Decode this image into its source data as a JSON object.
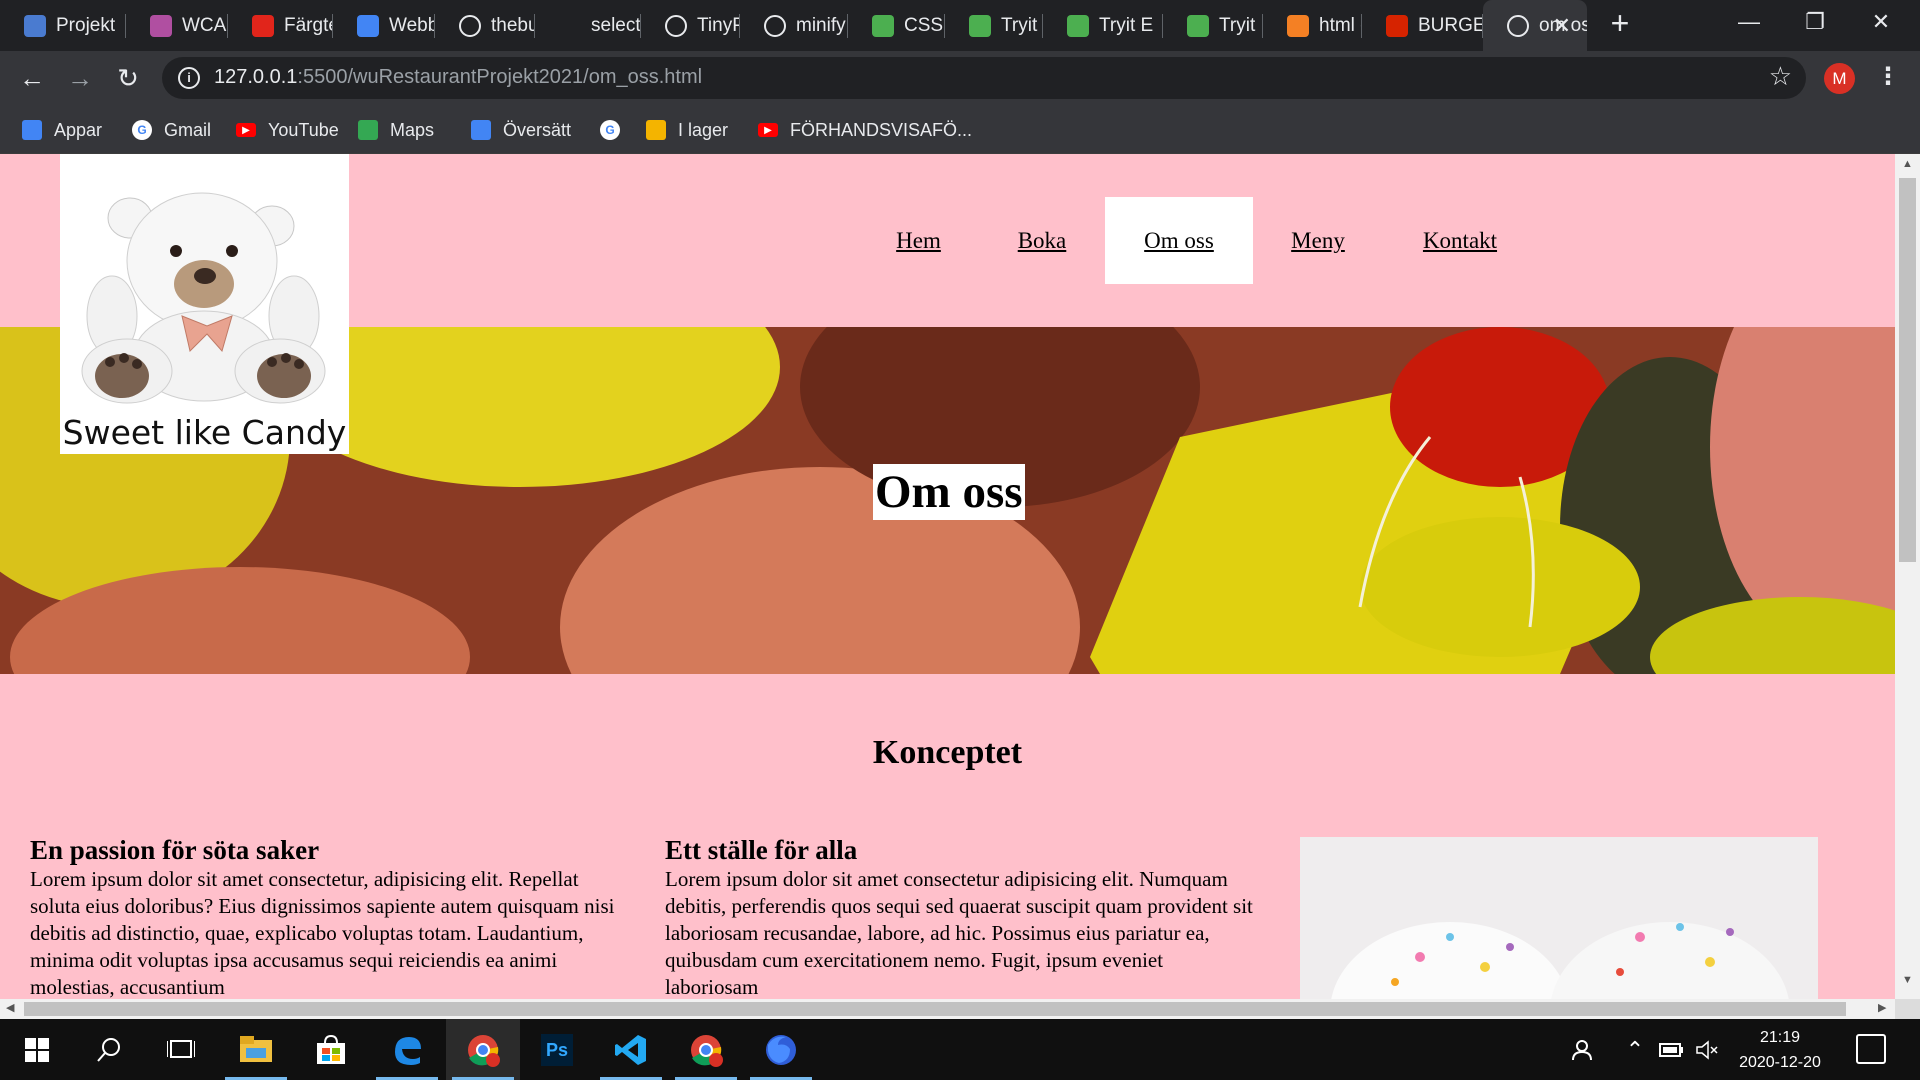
{
  "browser": {
    "tabs": [
      {
        "title": "Projekt",
        "icon": "contact-icon",
        "color": "#4a7bd0"
      },
      {
        "title": "WCAG",
        "icon": "wcag-icon",
        "color": "#b04fa1"
      },
      {
        "title": "Färgtema",
        "icon": "adobe-icon",
        "color": "#e1251b"
      },
      {
        "title": "Webbutveckling",
        "icon": "docs-icon",
        "color": "#4285f4"
      },
      {
        "title": "thebu",
        "icon": "globe-icon",
        "color": "#e8eaed"
      },
      {
        "title": "select",
        "icon": "none",
        "color": "#202124"
      },
      {
        "title": "TinyPNG",
        "icon": "panda-icon",
        "color": "#e8eaed"
      },
      {
        "title": "minify",
        "icon": "google-icon",
        "color": "#e8eaed"
      },
      {
        "title": "CSS Ir",
        "icon": "w3schools-icon",
        "color": "#4caf50"
      },
      {
        "title": "Tryit E",
        "icon": "w3schools-icon",
        "color": "#4caf50"
      },
      {
        "title": "Tryit E",
        "icon": "w3schools-icon",
        "color": "#4caf50"
      },
      {
        "title": "Tryit E",
        "icon": "w3schools-icon",
        "color": "#4caf50"
      },
      {
        "title": "html -",
        "icon": "stackoverflow-icon",
        "color": "#f48024"
      },
      {
        "title": "BURGER",
        "icon": "burgerking-icon",
        "color": "#d62300"
      },
      {
        "title": "om oss",
        "icon": "globe-icon",
        "color": "#e8eaed",
        "active": true
      }
    ],
    "url_host": "127.0.0.1",
    "url_rest": ":5500/wuRestaurantProjekt2021/om_oss.html",
    "bookmarks": [
      {
        "label": "Appar",
        "icon": "apps-grid-icon"
      },
      {
        "label": "Gmail",
        "icon": "google-icon"
      },
      {
        "label": "YouTube",
        "icon": "youtube-icon"
      },
      {
        "label": "Maps",
        "icon": "maps-pin-icon"
      },
      {
        "label": "Översätt",
        "icon": "translate-icon"
      },
      {
        "label": "",
        "icon": "google-icon"
      },
      {
        "label": "I lager",
        "icon": "chrome-icon"
      },
      {
        "label": "FÖRHANDSVISAFÖ...",
        "icon": "youtube-icon"
      }
    ],
    "profile_initial": "M"
  },
  "site": {
    "logo_text": "Sweet like Candy",
    "nav": [
      "Hem",
      "Boka",
      "Om oss",
      "Meny",
      "Kontakt"
    ],
    "active_nav": "Om oss",
    "hero_title": "Om oss",
    "section_title": "Konceptet",
    "columns": [
      {
        "heading": "En passion för söta saker",
        "text": "Lorem ipsum dolor sit amet consectetur, adipisicing elit. Repellat soluta eius doloribus? Eius dignissimos sapiente autem quisquam nisi debitis ad distinctio, quae, explicabo voluptas totam. Laudantium, minima odit voluptas ipsa accusamus sequi reiciendis ea animi molestias, accusantium"
      },
      {
        "heading": "Ett ställe för alla",
        "text": "Lorem ipsum dolor sit amet consectetur adipisicing elit. Numquam debitis, perferendis quos sequi sed quaerat suscipit quam provident sit laboriosam recusandae, labore, ad hic. Possimus eius pariatur ea, quibusdam cum exercitationem nemo. Fugit, ipsum eveniet laboriosam"
      }
    ]
  },
  "taskbar": {
    "apps": [
      "windows-start-icon",
      "search-icon",
      "task-view-icon",
      "file-explorer-icon",
      "microsoft-store-icon",
      "edge-icon",
      "chrome-icon",
      "photoshop-icon",
      "vscode-icon",
      "chrome-icon",
      "firefox-icon"
    ],
    "photoshop_label": "Ps",
    "time": "21:19",
    "date": "2020-12-20"
  },
  "colors": {
    "page_background": "#ffc0cb",
    "browser_chrome": "#35363a"
  }
}
